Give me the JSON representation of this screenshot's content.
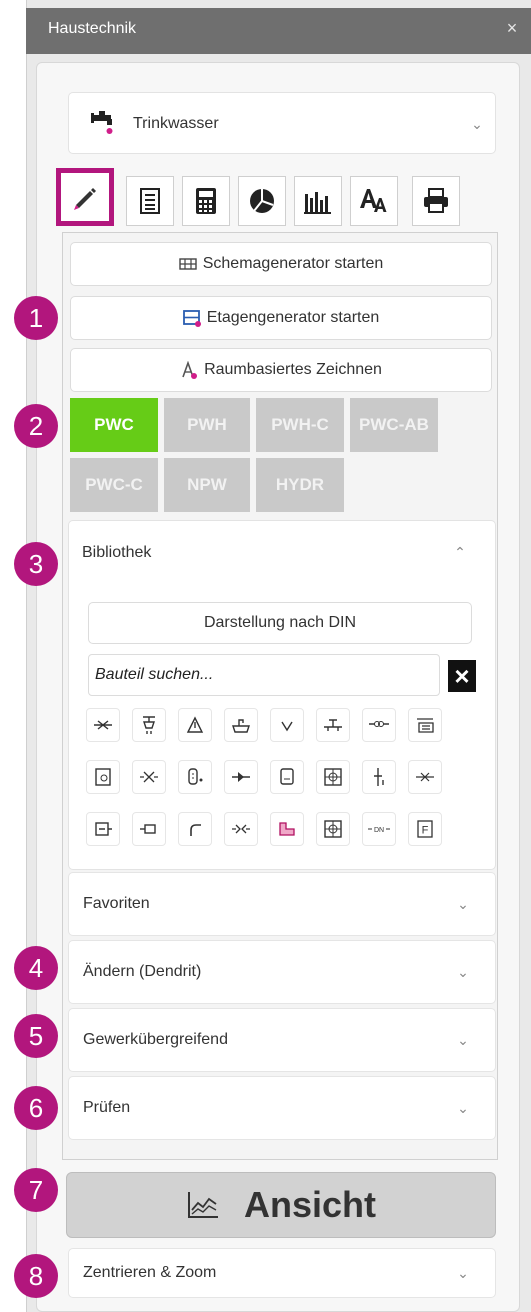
{
  "window": {
    "title": "Haustechnik",
    "close_label": "×"
  },
  "system_dropdown": {
    "value": "Trinkwasser"
  },
  "tabs": [
    {
      "name": "tab-draw",
      "icon": "pencil-icon"
    },
    {
      "name": "tab-list",
      "icon": "list-icon"
    },
    {
      "name": "tab-calculate",
      "icon": "calculator-icon"
    },
    {
      "name": "tab-chart",
      "icon": "pie-chart-icon"
    },
    {
      "name": "tab-bars",
      "icon": "bar-chart-icon"
    },
    {
      "name": "tab-text",
      "icon": "text-style-icon"
    },
    {
      "name": "tab-print",
      "icon": "printer-icon"
    }
  ],
  "generators": {
    "schema": "Schemagenerator starten",
    "etage": "Etagengenerator starten",
    "raum": "Raumbasiertes Zeichnen"
  },
  "media": [
    "PWC",
    "PWH",
    "PWH-C",
    "PWC-AB",
    "PWC-C",
    "NPW",
    "HYDR"
  ],
  "media_selected": "PWC",
  "bibliothek": {
    "title": "Bibliothek",
    "din_button": "Darstellung nach DIN",
    "search_value": "Bauteil suchen...",
    "clear_label": "×"
  },
  "sections": {
    "favoriten": "Favoriten",
    "aendern": "Ändern (Dendrit)",
    "gewerk": "Gewerkübergreifend",
    "pruefen": "Prüfen"
  },
  "view_button": "Ansicht",
  "zoom_dropdown": "Zentrieren & Zoom",
  "callouts": [
    "1",
    "2",
    "3",
    "4",
    "5",
    "6",
    "7",
    "8"
  ],
  "colors": {
    "accent": "#b2167d",
    "selected_medium": "#66cc17",
    "chip_inactive": "#c9c9c9"
  }
}
